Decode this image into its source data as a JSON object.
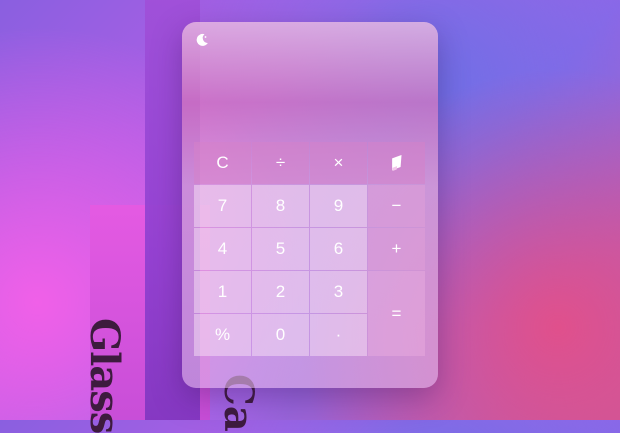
{
  "background": {
    "title_fragment": "Glass",
    "title_fragment_2": "Ca"
  },
  "calculator": {
    "theme_toggle_icon": "moon-icon",
    "display_value": "",
    "keys": [
      {
        "label": "C",
        "name": "clear-button",
        "style": "dark"
      },
      {
        "label": "÷",
        "name": "divide-button",
        "style": "dark"
      },
      {
        "label": "×",
        "name": "multiply-button",
        "style": "dark"
      },
      {
        "label": "",
        "name": "backspace-button",
        "style": "dark",
        "icon": "eraser-icon"
      },
      {
        "label": "7",
        "name": "key-7"
      },
      {
        "label": "8",
        "name": "key-8"
      },
      {
        "label": "9",
        "name": "key-9"
      },
      {
        "label": "−",
        "name": "subtract-button",
        "style": "op"
      },
      {
        "label": "4",
        "name": "key-4"
      },
      {
        "label": "5",
        "name": "key-5"
      },
      {
        "label": "6",
        "name": "key-6"
      },
      {
        "label": "+",
        "name": "add-button",
        "style": "op"
      },
      {
        "label": "1",
        "name": "key-1"
      },
      {
        "label": "2",
        "name": "key-2"
      },
      {
        "label": "3",
        "name": "key-3"
      },
      {
        "label": "=",
        "name": "equals-button",
        "style": "equals"
      },
      {
        "label": "%",
        "name": "percent-button"
      },
      {
        "label": "0",
        "name": "key-0"
      },
      {
        "label": "·",
        "name": "decimal-button"
      }
    ]
  }
}
